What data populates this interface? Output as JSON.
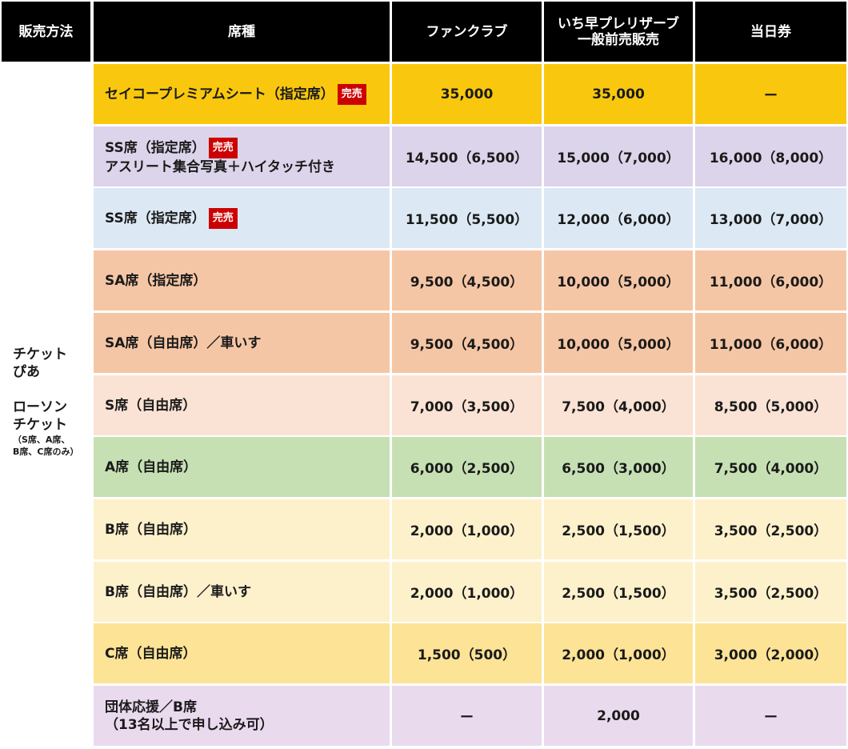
{
  "headers": {
    "method": "販売方法",
    "seat": "席種",
    "fanclub": "ファンクラブ",
    "presale_line1": "いち早プレリザーブ",
    "presale_line2": "一般前売販売",
    "dayof": "当日券"
  },
  "method_cell": {
    "line1": "チケット",
    "line2": "ぴあ",
    "line3": "ローソン",
    "line4": "チケット",
    "note1": "（S席、A席、",
    "note2": "B席、C席のみ）"
  },
  "soldout_label": "完売",
  "colors": {
    "header_bg": "#000000",
    "soldout_badge": "#cc0000",
    "row_premium": "#f9c80e",
    "row_ss_photo": "#dcd4ea",
    "row_ss": "#dce9f5",
    "row_sa": "#f5c6a5",
    "row_s": "#fae3d4",
    "row_a": "#c6e0b4",
    "row_b": "#fdf1cc",
    "row_c": "#fde396",
    "row_group": "#eadaee"
  },
  "rows": [
    {
      "seat_line1": "セイコープレミアムシート（指定席）",
      "seat_line2": "",
      "soldout": true,
      "fanclub": "35,000",
      "presale": "35,000",
      "dayof": "ー"
    },
    {
      "seat_line1": "SS席（指定席）",
      "seat_line2": "アスリート集合写真＋ハイタッチ付き",
      "soldout": true,
      "fanclub": "14,500（6,500）",
      "presale": "15,000（7,000）",
      "dayof": "16,000（8,000）"
    },
    {
      "seat_line1": "SS席（指定席）",
      "seat_line2": "",
      "soldout": true,
      "fanclub": "11,500（5,500）",
      "presale": "12,000（6,000）",
      "dayof": "13,000（7,000）"
    },
    {
      "seat_line1": "SA席（指定席）",
      "seat_line2": "",
      "soldout": false,
      "fanclub": "9,500（4,500）",
      "presale": "10,000（5,000）",
      "dayof": "11,000（6,000）"
    },
    {
      "seat_line1": "SA席（自由席）／車いす",
      "seat_line2": "",
      "soldout": false,
      "fanclub": "9,500（4,500）",
      "presale": "10,000（5,000）",
      "dayof": "11,000（6,000）"
    },
    {
      "seat_line1": "S席（自由席）",
      "seat_line2": "",
      "soldout": false,
      "fanclub": "7,000（3,500）",
      "presale": "7,500（4,000）",
      "dayof": "8,500（5,000）"
    },
    {
      "seat_line1": "A席（自由席）",
      "seat_line2": "",
      "soldout": false,
      "fanclub": "6,000（2,500）",
      "presale": "6,500（3,000）",
      "dayof": "7,500（4,000）"
    },
    {
      "seat_line1": "B席（自由席）",
      "seat_line2": "",
      "soldout": false,
      "fanclub": "2,000（1,000）",
      "presale": "2,500（1,500）",
      "dayof": "3,500（2,500）"
    },
    {
      "seat_line1": "B席（自由席）／車いす",
      "seat_line2": "",
      "soldout": false,
      "fanclub": "2,000（1,000）",
      "presale": "2,500（1,500）",
      "dayof": "3,500（2,500）"
    },
    {
      "seat_line1": "C席（自由席）",
      "seat_line2": "",
      "soldout": false,
      "fanclub": "1,500（500）",
      "presale": "2,000（1,000）",
      "dayof": "3,000（2,000）"
    },
    {
      "seat_line1": "団体応援／B席",
      "seat_line2": "（13名以上で申し込み可）",
      "soldout": false,
      "fanclub": "ー",
      "presale": "2,000",
      "dayof": "ー"
    }
  ]
}
